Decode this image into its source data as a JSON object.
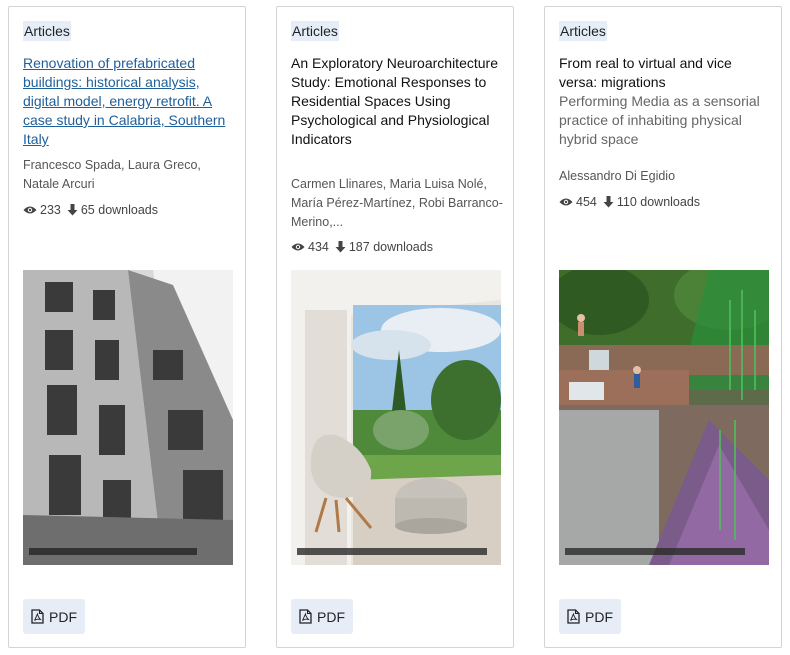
{
  "colors": {
    "badge_bg": "#e6edf7",
    "link": "#1f5f9a",
    "border": "#d4d4d4"
  },
  "cards": [
    {
      "category": "Articles",
      "title": "Renovation of prefabricated buildings: historical analysis, digital model, energy retrofit. A case study in Calabria, Southern Italy",
      "title_is_link": true,
      "subtitle": "",
      "authors": "Francesco Spada, Laura Greco, Natale Arcuri",
      "views": "233",
      "downloads": "65 downloads",
      "image": "building-facade-photo",
      "pdf_label": "PDF"
    },
    {
      "category": "Articles",
      "title": "An Exploratory Neuroarchitecture Study: Emotional Responses to Residential Spaces Using Psychological and Physiological Indicators",
      "title_is_link": false,
      "subtitle": "",
      "authors": "Carmen Llinares, Maria Luisa Nolé, María Pérez-Martínez, Robi Barranco-Merino,...",
      "views": "434",
      "downloads": "187 downloads",
      "image": "interior-chair-window-photo",
      "pdf_label": "PDF"
    },
    {
      "category": "Articles",
      "title": "From real to virtual and vice versa: migrations",
      "title_is_link": false,
      "subtitle": "Performing Media as a sensorial practice of inhabiting physical hybrid space",
      "authors": "Alessandro Di Egidio",
      "views": "454",
      "downloads": "110 downloads",
      "image": "fountain-glitch-photo",
      "pdf_label": "PDF"
    }
  ]
}
